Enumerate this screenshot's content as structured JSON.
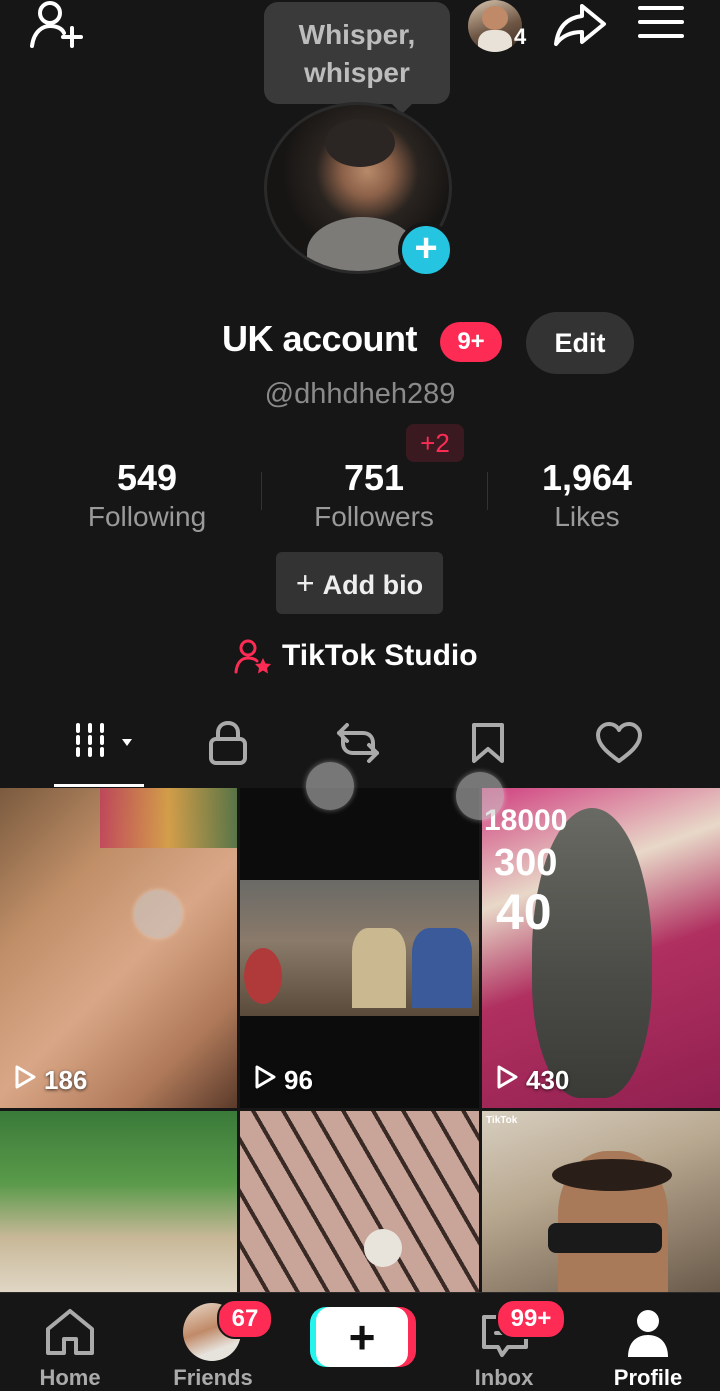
{
  "header": {
    "story_count": "4",
    "tooltip": "Whisper, whisper"
  },
  "profile": {
    "display_name": "UK account",
    "name_badge": "9+",
    "edit_label": "Edit",
    "username": "@dhhdheh289",
    "new_followers": "+2",
    "stats": {
      "following_count": "549",
      "following_label": "Following",
      "followers_count": "751",
      "followers_label": "Followers",
      "likes_count": "1,964",
      "likes_label": "Likes"
    },
    "add_bio_label": "Add bio",
    "studio_label": "TikTok Studio"
  },
  "tabs": [
    "videos-icon",
    "lock-icon",
    "repost-icon",
    "bookmark-icon",
    "heart-icon"
  ],
  "videos": [
    {
      "views": "186"
    },
    {
      "views": "96"
    },
    {
      "views": "430",
      "overlay_text": [
        "18000",
        "300",
        "40"
      ]
    },
    {
      "views": ""
    },
    {
      "views": ""
    },
    {
      "views": "",
      "watermark": "TikTok"
    }
  ],
  "nav": {
    "home": "Home",
    "friends": "Friends",
    "friends_badge": "67",
    "inbox": "Inbox",
    "inbox_badge": "99+",
    "profile": "Profile"
  },
  "colors": {
    "background": "#161616",
    "accent_red": "#fe2c55",
    "accent_cyan": "#25c4e0"
  }
}
